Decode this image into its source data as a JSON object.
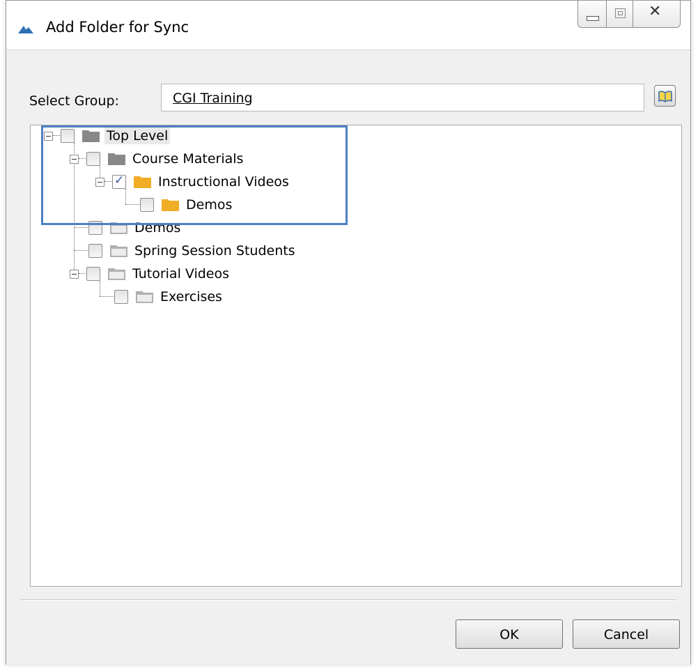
{
  "window": {
    "title": "Add Folder for Sync",
    "close_glyph": "✕"
  },
  "form": {
    "group_label": "Select Group:",
    "group_value": "CGI Training"
  },
  "tree": {
    "items": [
      {
        "label": "Top Level",
        "checked": false,
        "folder_color": "#888888",
        "selected": true
      },
      {
        "label": "Course Materials",
        "checked": false,
        "folder_color": "#888888"
      },
      {
        "label": "Instructional Videos",
        "checked": true,
        "folder_color": "#f1ad25"
      },
      {
        "label": "Demos",
        "checked": false,
        "folder_color": "#f1ad25"
      },
      {
        "label": "Demos",
        "checked": false,
        "folder_color": "#b0b0b0"
      },
      {
        "label": "Spring Session Students",
        "checked": false,
        "folder_color": "#b0b0b0"
      },
      {
        "label": "Tutorial Videos",
        "checked": false,
        "folder_color": "#b0b0b0"
      },
      {
        "label": "Exercises",
        "checked": false,
        "folder_color": "#b0b0b0"
      }
    ],
    "check_glyph": "✓"
  },
  "buttons": {
    "ok": "OK",
    "cancel": "Cancel"
  },
  "colors": {
    "highlight": "#4d7fc4",
    "folder_active": "#f1ad25",
    "folder_dark": "#888888",
    "folder_light": "#b0b0b0"
  }
}
